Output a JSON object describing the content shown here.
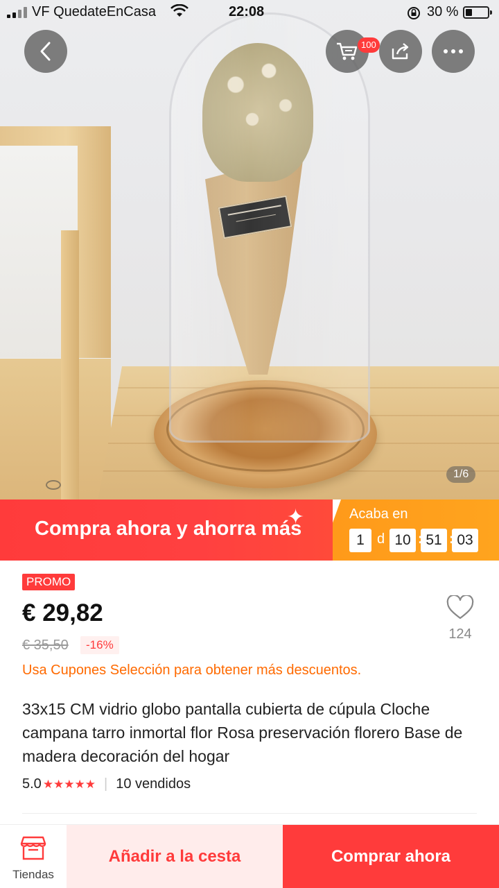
{
  "status_bar": {
    "carrier": "VF QuedateEnCasa",
    "time": "22:08",
    "battery": "30 %",
    "battery_level": 0.3
  },
  "image_viewer": {
    "cart_count": "100",
    "counter": "1/6"
  },
  "banner": {
    "title": "Compra ahora y ahorra más",
    "ends_label": "Acaba en",
    "days": "1",
    "days_unit": "d",
    "hours": "10",
    "minutes": "51",
    "seconds": "03",
    "colors": {
      "left": "#ff3b3b",
      "right": "#ffa41e"
    }
  },
  "product": {
    "promo_tag": "PROMO",
    "price": "€ 29,82",
    "old_price": "€ 35,50",
    "discount": "-16%",
    "wishlist_count": "124",
    "coupon_text": "Usa Cupones Selección para obtener más descuentos.",
    "title": "33x15 CM vidrio globo pantalla cubierta de cúpula Cloche campana tarro inmortal flor Rosa preservación florero Base de madera decoración del hogar",
    "rating": "5.0",
    "stars": "★★★★★",
    "divider": "|",
    "sold": "10 vendidos"
  },
  "bottom_bar": {
    "stores_label": "Tiendas",
    "add_to_cart": "Añadir a la cesta",
    "buy_now": "Comprar ahora"
  },
  "icons": [
    "back-arrow-icon",
    "cart-icon",
    "share-icon",
    "more-icon",
    "heart-icon",
    "store-icon",
    "wifi-icon",
    "battery-icon"
  ],
  "accent_color": "#ff3b3b"
}
